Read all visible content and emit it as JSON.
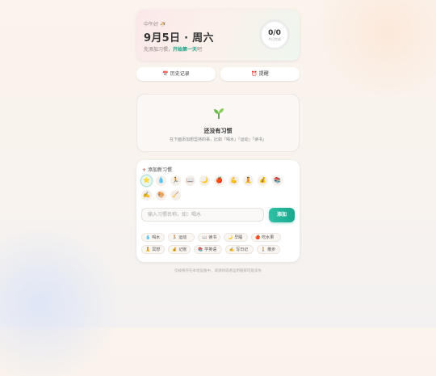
{
  "header": {
    "greeting": "中午好 🍜",
    "date": "9月5日 · 周六",
    "subtitle_prefix": "先添加习惯，",
    "subtitle_link": "开始第一天",
    "subtitle_suffix": "吧",
    "progress_value": "0/0",
    "progress_label": "今日完成"
  },
  "actions": {
    "history_icon": "📅",
    "history_label": "历史记录",
    "remind_icon": "⏰",
    "remind_label": "提醒"
  },
  "empty_state": {
    "icon": "sprout-icon",
    "title": "还没有习惯",
    "hint": "在下面添加想坚持的事，比如「喝水」「运动」「读书」"
  },
  "add_habit": {
    "title": "添加新习惯",
    "icons": [
      {
        "glyph": "⭐",
        "name": "star"
      },
      {
        "glyph": "💧",
        "name": "water-drop"
      },
      {
        "glyph": "🏃",
        "name": "runner"
      },
      {
        "glyph": "📖",
        "name": "open-book"
      },
      {
        "glyph": "🌙",
        "name": "moon"
      },
      {
        "glyph": "🍎",
        "name": "apple"
      },
      {
        "glyph": "💪",
        "name": "muscle"
      },
      {
        "glyph": "🧘",
        "name": "meditation"
      },
      {
        "glyph": "💰",
        "name": "money-bag"
      },
      {
        "glyph": "📚",
        "name": "books"
      },
      {
        "glyph": "✍️",
        "name": "writing-hand"
      },
      {
        "glyph": "🎨",
        "name": "palette"
      },
      {
        "glyph": "🧹",
        "name": "broom"
      }
    ],
    "selected_icon": "star",
    "input_placeholder": "输入习惯名称，如：喝水",
    "input_value": "",
    "submit_label": "添加",
    "suggestions": [
      {
        "glyph": "💧",
        "label": "喝水"
      },
      {
        "glyph": "🏃",
        "label": "运动"
      },
      {
        "glyph": "📖",
        "label": "读书"
      },
      {
        "glyph": "🌙",
        "label": "早睡"
      },
      {
        "glyph": "🍎",
        "label": "吃水果"
      },
      {
        "glyph": "🧘",
        "label": "冥想"
      },
      {
        "glyph": "💰",
        "label": "记账"
      },
      {
        "glyph": "📚",
        "label": "学英语"
      },
      {
        "glyph": "✍️",
        "label": "写日记"
      },
      {
        "glyph": "🚶",
        "label": "散步"
      }
    ]
  },
  "footer": {
    "text": "仅被保存在本地设备中，请清除或者运用随即可能丢失"
  }
}
